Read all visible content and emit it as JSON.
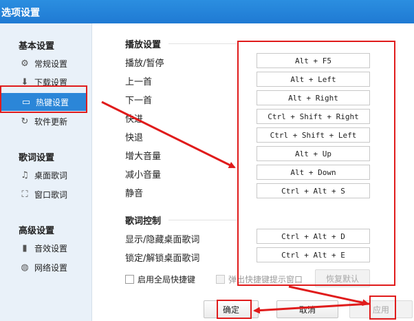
{
  "window": {
    "title": "选项设置"
  },
  "sidebar": {
    "groups": [
      {
        "title": "基本设置",
        "items": [
          {
            "label": "常规设置",
            "icon": "gear-icon"
          },
          {
            "label": "下载设置",
            "icon": "download-icon"
          },
          {
            "label": "热键设置",
            "icon": "keyboard-icon",
            "active": true
          },
          {
            "label": "软件更新",
            "icon": "refresh-icon"
          }
        ]
      },
      {
        "title": "歌词设置",
        "items": [
          {
            "label": "桌面歌词",
            "icon": "lyrics-icon"
          },
          {
            "label": "窗口歌词",
            "icon": "window-icon"
          }
        ]
      },
      {
        "title": "高级设置",
        "items": [
          {
            "label": "音效设置",
            "icon": "equalizer-icon"
          },
          {
            "label": "网络设置",
            "icon": "network-icon"
          }
        ]
      }
    ]
  },
  "playback": {
    "title": "播放设置",
    "rows": [
      {
        "label": "播放/暂停",
        "hotkey": "Alt + F5"
      },
      {
        "label": "上一首",
        "hotkey": "Alt + Left"
      },
      {
        "label": "下一首",
        "hotkey": "Alt + Right"
      },
      {
        "label": "快进",
        "hotkey": "Ctrl + Shift + Right"
      },
      {
        "label": "快退",
        "hotkey": "Ctrl + Shift + Left"
      },
      {
        "label": "增大音量",
        "hotkey": "Alt + Up"
      },
      {
        "label": "减小音量",
        "hotkey": "Alt + Down"
      },
      {
        "label": "静音",
        "hotkey": "Ctrl + Alt + S"
      }
    ]
  },
  "lyrics_control": {
    "title": "歌词控制",
    "rows": [
      {
        "label": "显示/隐藏桌面歌词",
        "hotkey": "Ctrl + Alt + D"
      },
      {
        "label": "锁定/解锁桌面歌词",
        "hotkey": "Ctrl + Alt + E"
      }
    ]
  },
  "options": {
    "global_hotkey_label": "启用全局快捷键",
    "conflict_popup_label": "弹出快捷键提示窗口",
    "restore_default_label": "恢复默认"
  },
  "footer": {
    "ok_label": "确定",
    "cancel_label": "取消",
    "apply_label": "应用"
  },
  "colors": {
    "title_bar": "#1f7ad3",
    "active_item": "#2b86d8",
    "annotation": "#e01b1b"
  }
}
